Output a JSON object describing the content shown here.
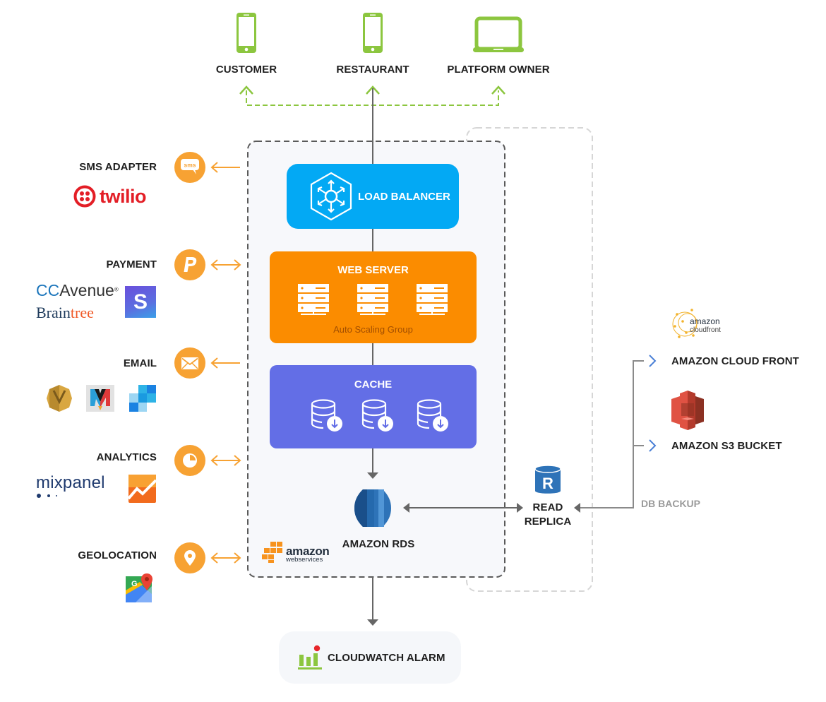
{
  "top_nodes": [
    {
      "label": "CUSTOMER",
      "icon": "smartphone-icon"
    },
    {
      "label": "RESTAURANT",
      "icon": "smartphone-icon"
    },
    {
      "label": "PLATFORM OWNER",
      "icon": "laptop-icon"
    }
  ],
  "services": [
    {
      "label": "SMS ADAPTER",
      "icon": "sms-icon",
      "direction": "outgoing",
      "providers": [
        "twilio"
      ]
    },
    {
      "label": "PAYMENT",
      "icon": "paypal-icon",
      "direction": "bidirectional",
      "providers": [
        "CCAvenue",
        "Braintree",
        "Stripe"
      ]
    },
    {
      "label": "EMAIL",
      "icon": "envelope-icon",
      "direction": "outgoing",
      "providers": [
        "Amazon SES",
        "Mandrill",
        "SendGrid"
      ]
    },
    {
      "label": "ANALYTICS",
      "icon": "pie-chart-icon",
      "direction": "bidirectional",
      "providers": [
        "mixpanel",
        "Google Analytics"
      ]
    },
    {
      "label": "GEOLOCATION",
      "icon": "map-pin-icon",
      "direction": "bidirectional",
      "providers": [
        "Google Maps"
      ]
    }
  ],
  "logos": {
    "twilio": "twilio",
    "ccavenue_cc": "CC",
    "ccavenue_rest": "Avenue",
    "ccavenue_reg": "®",
    "braintree_a": "Bra",
    "braintree_i": "i",
    "braintree_n": "n",
    "braintree_tree": "tree",
    "stripe": "S",
    "mixpanel": "mixpanel",
    "aws_amazon": "amazon",
    "aws_ws": "webservices",
    "cloudfront_amazon": "amazon",
    "cloudfront_name": "cloudfront",
    "google_g": "G",
    "replica_r": "R"
  },
  "aws": {
    "load_balancer": "LOAD BALANCER",
    "web_server": "WEB SERVER",
    "auto_scaling": "Auto Scaling Group",
    "cache": "CACHE",
    "rds": "AMAZON RDS",
    "read_replica_line1": "READ",
    "read_replica_line2": "REPLICA"
  },
  "storage": {
    "cloudfront": "AMAZON CLOUD FRONT",
    "s3": "AMAZON S3 BUCKET",
    "db_backup": "DB BACKUP"
  },
  "monitoring": {
    "cloudwatch": "CLOUDWATCH ALARM"
  },
  "colors": {
    "green": "#8cc63f",
    "orange_service": "#f7a233",
    "load_balancer": "#03a9f4",
    "web_server": "#fb8c00",
    "cache": "#636ee6",
    "rds_blue": "#2e73b8",
    "s3_red": "#e05243",
    "arrow_gray": "#666666",
    "backup_blue": "#4a7fd6"
  }
}
